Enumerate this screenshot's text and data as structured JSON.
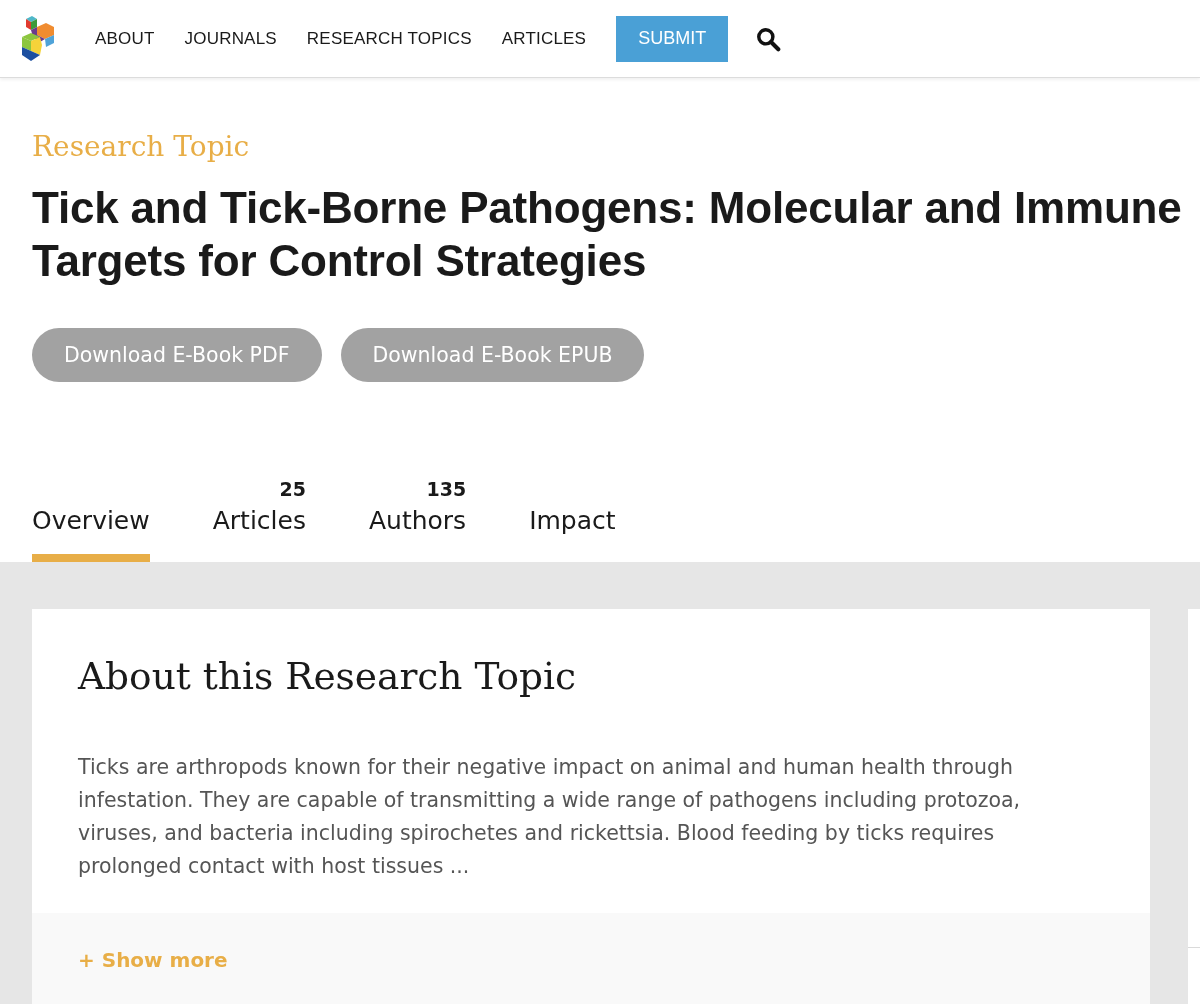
{
  "header": {
    "nav": [
      {
        "label": "ABOUT"
      },
      {
        "label": "JOURNALS"
      },
      {
        "label": "RESEARCH TOPICS"
      },
      {
        "label": "ARTICLES"
      }
    ],
    "submit": "SUBMIT"
  },
  "topic": {
    "eyebrow": "Research Topic",
    "title": "Tick and Tick-Borne Pathogens: Molecular and Immune Targets for Control Strategies",
    "downloads": [
      "Download E-Book PDF",
      "Download E-Book EPUB"
    ]
  },
  "tabs": [
    {
      "label": "Overview",
      "selected": true
    },
    {
      "label": "Articles",
      "count": "25",
      "selected": false
    },
    {
      "label": "Authors",
      "count": "135",
      "selected": false
    },
    {
      "label": "Impact",
      "selected": false
    }
  ],
  "about": {
    "heading": "About this Research Topic",
    "text": "Ticks are arthropods known for their negative impact on animal and human health through infestation. They are capable of transmitting a wide range of pathogens including protozoa, viruses, and bacteria including spirochetes and rickettsia. Blood feeding by ticks requires prolonged contact with host tissues ...",
    "show_more": "+ Show more"
  }
}
